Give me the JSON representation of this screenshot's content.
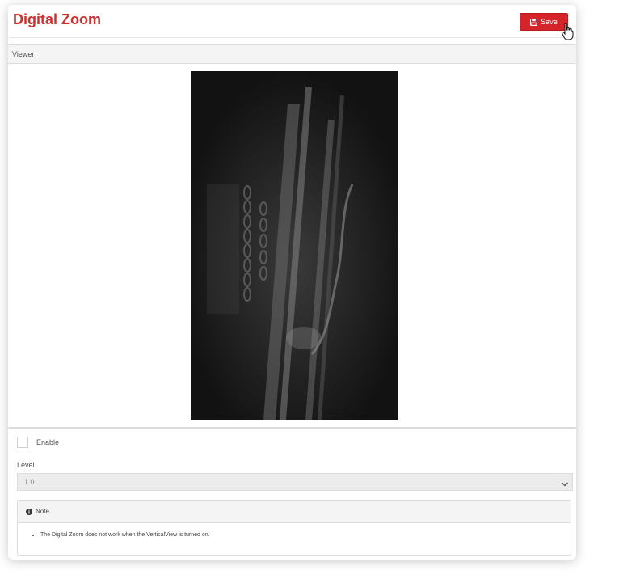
{
  "header": {
    "title": "Digital Zoom",
    "save_label": "Save"
  },
  "viewer": {
    "heading": "Viewer"
  },
  "controls": {
    "enable_label": "Enable",
    "enable_checked": false,
    "level_label": "Level",
    "level_value": "1.0"
  },
  "note": {
    "heading": "Note",
    "items": [
      "The Digital Zoom does not work when the VerticalView is turned on."
    ]
  },
  "colors": {
    "accent": "#d32f2f",
    "save_button": "#d5252b"
  },
  "icons": {
    "save": "floppy-disk",
    "cursor": "hand-pointer",
    "chevron": "chevron-down",
    "info": "info-circle"
  }
}
